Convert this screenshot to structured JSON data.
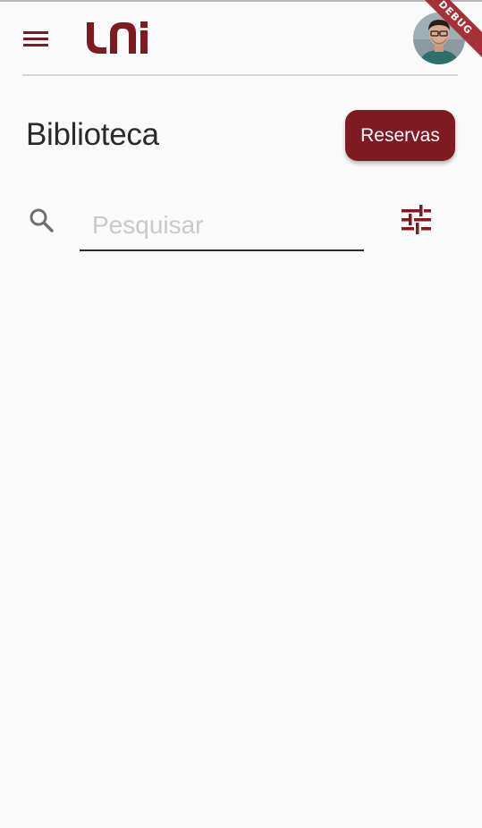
{
  "colors": {
    "brand": "#7d1a22",
    "background": "#fafafa",
    "title_text": "#2a2a2a",
    "placeholder": "#c9c9c9",
    "debug_ribbon": "#a63038"
  },
  "header": {
    "menu_icon": "hamburger-menu-icon",
    "logo_text": "uni",
    "avatar_icon": "user-avatar",
    "debug_banner": "DEBUG"
  },
  "page": {
    "title": "Biblioteca",
    "reservas_label": "Reservas"
  },
  "search": {
    "icon": "search-icon",
    "placeholder": "Pesquisar",
    "value": "",
    "filter_icon": "tune-filter-icon"
  }
}
